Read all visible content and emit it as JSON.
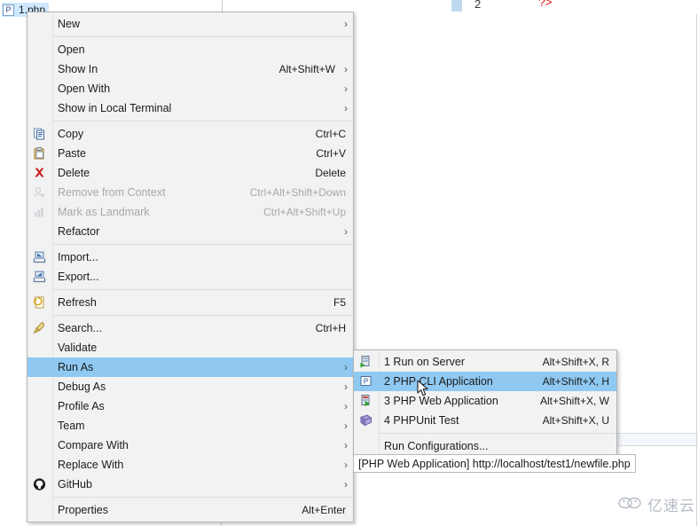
{
  "background": {
    "file_label": "1.php",
    "file_icon": "php-file-icon",
    "code_line_number": "2",
    "code_fragment": "?>"
  },
  "context_menu": {
    "items": [
      {
        "label": "New",
        "accel": "",
        "arrow": true,
        "icon": "",
        "disabled": false,
        "selected": false
      },
      {
        "sep": true
      },
      {
        "label": "Open",
        "accel": "",
        "arrow": false,
        "icon": "",
        "disabled": false,
        "selected": false
      },
      {
        "label": "Show In",
        "accel": "Alt+Shift+W",
        "arrow": true,
        "icon": "",
        "disabled": false,
        "selected": false
      },
      {
        "label": "Open With",
        "accel": "",
        "arrow": true,
        "icon": "",
        "disabled": false,
        "selected": false
      },
      {
        "label": "Show in Local Terminal",
        "accel": "",
        "arrow": true,
        "icon": "",
        "disabled": false,
        "selected": false
      },
      {
        "sep": true
      },
      {
        "label": "Copy",
        "accel": "Ctrl+C",
        "arrow": false,
        "icon": "copy-icon",
        "disabled": false,
        "selected": false
      },
      {
        "label": "Paste",
        "accel": "Ctrl+V",
        "arrow": false,
        "icon": "paste-icon",
        "disabled": false,
        "selected": false
      },
      {
        "label": "Delete",
        "accel": "Delete",
        "arrow": false,
        "icon": "delete-icon",
        "disabled": false,
        "selected": false
      },
      {
        "label": "Remove from Context",
        "accel": "Ctrl+Alt+Shift+Down",
        "arrow": false,
        "icon": "remove-from-context-icon",
        "disabled": true,
        "selected": false
      },
      {
        "label": "Mark as Landmark",
        "accel": "Ctrl+Alt+Shift+Up",
        "arrow": false,
        "icon": "mark-as-landmark-icon",
        "disabled": true,
        "selected": false
      },
      {
        "label": "Refactor",
        "accel": "",
        "arrow": true,
        "icon": "",
        "disabled": false,
        "selected": false
      },
      {
        "sep": true
      },
      {
        "label": "Import...",
        "accel": "",
        "arrow": false,
        "icon": "import-icon",
        "disabled": false,
        "selected": false
      },
      {
        "label": "Export...",
        "accel": "",
        "arrow": false,
        "icon": "export-icon",
        "disabled": false,
        "selected": false
      },
      {
        "sep": true
      },
      {
        "label": "Refresh",
        "accel": "F5",
        "arrow": false,
        "icon": "refresh-icon",
        "disabled": false,
        "selected": false
      },
      {
        "sep": true
      },
      {
        "label": "Search...",
        "accel": "Ctrl+H",
        "arrow": false,
        "icon": "search-icon",
        "disabled": false,
        "selected": false
      },
      {
        "label": "Validate",
        "accel": "",
        "arrow": false,
        "icon": "",
        "disabled": false,
        "selected": false
      },
      {
        "label": "Run As",
        "accel": "",
        "arrow": true,
        "icon": "",
        "disabled": false,
        "selected": true
      },
      {
        "label": "Debug As",
        "accel": "",
        "arrow": true,
        "icon": "",
        "disabled": false,
        "selected": false
      },
      {
        "label": "Profile As",
        "accel": "",
        "arrow": true,
        "icon": "",
        "disabled": false,
        "selected": false
      },
      {
        "label": "Team",
        "accel": "",
        "arrow": true,
        "icon": "",
        "disabled": false,
        "selected": false
      },
      {
        "label": "Compare With",
        "accel": "",
        "arrow": true,
        "icon": "",
        "disabled": false,
        "selected": false
      },
      {
        "label": "Replace With",
        "accel": "",
        "arrow": true,
        "icon": "",
        "disabled": false,
        "selected": false
      },
      {
        "label": "GitHub",
        "accel": "",
        "arrow": true,
        "icon": "github-icon",
        "disabled": false,
        "selected": false
      },
      {
        "sep": true
      },
      {
        "label": "Properties",
        "accel": "Alt+Enter",
        "arrow": false,
        "icon": "",
        "disabled": false,
        "selected": false
      }
    ]
  },
  "run_as_submenu": {
    "items": [
      {
        "label": "1 Run on Server",
        "accel": "Alt+Shift+X, R",
        "icon": "run-on-server-icon",
        "selected": false
      },
      {
        "label": "2 PHP CLI Application",
        "accel": "Alt+Shift+X, H",
        "icon": "php-cli-icon",
        "selected": true
      },
      {
        "label": "3 PHP Web Application",
        "accel": "Alt+Shift+X, W",
        "icon": "php-web-icon",
        "selected": false
      },
      {
        "label": "4 PHPUnit Test",
        "accel": "Alt+Shift+X, U",
        "icon": "phpunit-icon",
        "selected": false
      },
      {
        "sep": true
      },
      {
        "label": "Run Configurations...",
        "accel": "",
        "icon": "",
        "selected": false
      }
    ]
  },
  "tooltip": {
    "text": "[PHP Web Application] http://localhost/test1/newfile.php"
  },
  "watermark": {
    "text": "亿速云",
    "icon": "cloud-logo-icon"
  },
  "colors": {
    "menu_bg": "#f2f2f2",
    "selection": "#8fc9f2",
    "text": "#1b1b1b",
    "disabled_text": "#a8a8a8"
  }
}
